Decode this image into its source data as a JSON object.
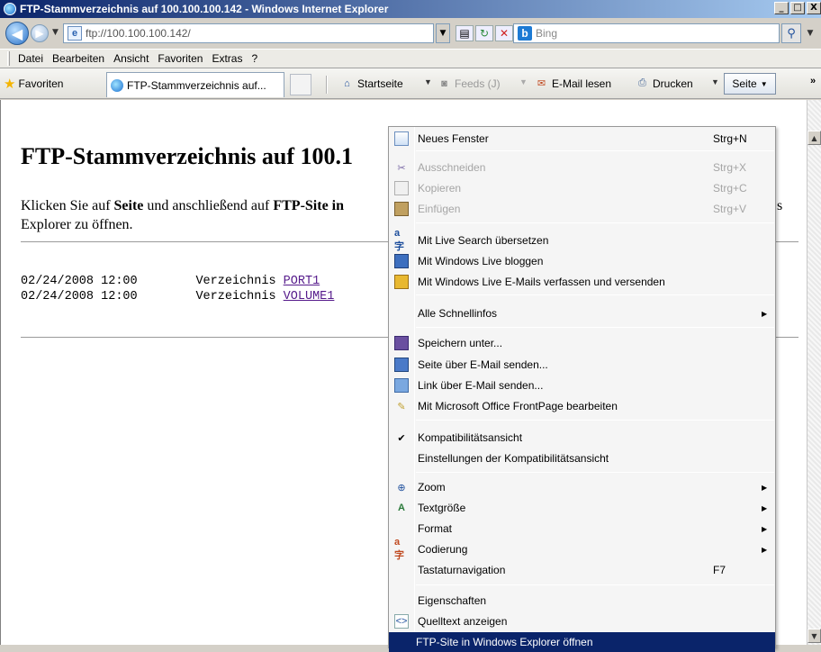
{
  "window": {
    "title": "FTP-Stammverzeichnis auf 100.100.100.142 - Windows Internet Explorer",
    "controls": {
      "minimize": "_",
      "maximize": "□",
      "close": "X"
    }
  },
  "addressbar": {
    "url": "ftp://100.100.100.142/",
    "search_placeholder": "Bing"
  },
  "menubar": {
    "items": [
      "Datei",
      "Bearbeiten",
      "Ansicht",
      "Favoriten",
      "Extras",
      "?"
    ]
  },
  "commandbar": {
    "favorites_label": "Favoriten",
    "tab_title": "FTP-Stammverzeichnis auf...",
    "startseite": "Startseite",
    "feeds": "Feeds (J)",
    "email": "E-Mail lesen",
    "drucken": "Drucken",
    "seite": "Seite"
  },
  "page": {
    "heading": "FTP-Stammverzeichnis auf 100.1",
    "instruction_pre": "Klicken Sie auf ",
    "instruction_seite": "Seite",
    "instruction_mid": " und anschließend auf ",
    "instruction_ftp": "FTP-Site in",
    "instruction_end": "Explorer zu öffnen.",
    "instruction_s": "s",
    "entries": [
      {
        "date": "02/24/2008 12:00",
        "type": "Verzeichnis",
        "name": "PORT1"
      },
      {
        "date": "02/24/2008 12:00",
        "type": "Verzeichnis",
        "name": "VOLUME1"
      }
    ]
  },
  "menu": {
    "items": [
      {
        "label": "Neues Fenster",
        "shortcut": "Strg+N",
        "icon": "new-window-icon",
        "disabled": false
      },
      {
        "label": "Ausschneiden",
        "shortcut": "Strg+X",
        "icon": "cut-icon",
        "disabled": true
      },
      {
        "label": "Kopieren",
        "shortcut": "Strg+C",
        "icon": "copy-icon",
        "disabled": true
      },
      {
        "label": "Einfügen",
        "shortcut": "Strg+V",
        "icon": "paste-icon",
        "disabled": true
      },
      {
        "label": "Mit Live Search übersetzen",
        "icon": "translate-icon"
      },
      {
        "label": "Mit Windows Live bloggen",
        "icon": "blog-icon"
      },
      {
        "label": "Mit Windows Live E-Mails verfassen und versenden",
        "icon": "mail-icon"
      },
      {
        "label": "Alle Schnellinfos",
        "submenu": true
      },
      {
        "label": "Speichern unter...",
        "icon": "save-icon"
      },
      {
        "label": "Seite über E-Mail senden...",
        "icon": "send-page-icon"
      },
      {
        "label": "Link über E-Mail senden...",
        "icon": "send-link-icon"
      },
      {
        "label": "Mit Microsoft Office FrontPage bearbeiten",
        "icon": "frontpage-icon"
      },
      {
        "label": "Kompatibilitätsansicht",
        "checked": true,
        "icon": "checkmark-icon"
      },
      {
        "label": "Einstellungen der Kompatibilitätsansicht"
      },
      {
        "label": "Zoom",
        "icon": "zoom-icon",
        "submenu": true
      },
      {
        "label": "Textgröße",
        "icon": "text-size-icon",
        "submenu": true
      },
      {
        "label": "Format",
        "submenu": true
      },
      {
        "label": "Codierung",
        "icon": "encoding-icon",
        "submenu": true
      },
      {
        "label": "Tastaturnavigation",
        "shortcut": "F7"
      },
      {
        "label": "Eigenschaften"
      },
      {
        "label": "Quelltext anzeigen",
        "icon": "source-icon"
      },
      {
        "label": "FTP-Site in Windows Explorer öffnen",
        "highlighted": true
      }
    ]
  },
  "colors": {
    "title_gradient_start": "#0a246a",
    "highlight": "#0a246a",
    "visited_link": "#551a8b"
  }
}
